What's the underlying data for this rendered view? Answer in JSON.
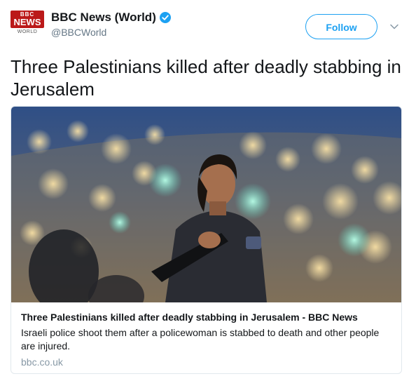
{
  "account": {
    "logo_line1": "BBC",
    "logo_line2": "NEWS",
    "logo_line3": "WORLD",
    "display_name": "BBC News (World)",
    "handle": "@BBCWorld",
    "follow_label": "Follow"
  },
  "tweet": {
    "text": "Three Palestinians killed after deadly stabbing in Jerusalem"
  },
  "card": {
    "title": "Three Palestinians killed after deadly stabbing in Jerusalem - BBC News",
    "description": "Israeli police shoot them after a policewoman is stabbed to death and other people are injured.",
    "domain": "bbc.co.uk"
  },
  "icons": {
    "verified": "verified-badge-icon",
    "caret": "chevron-down-icon"
  },
  "colors": {
    "brand_red": "#bb1919",
    "twitter_blue": "#1da1f2",
    "secondary_text": "#657786"
  }
}
